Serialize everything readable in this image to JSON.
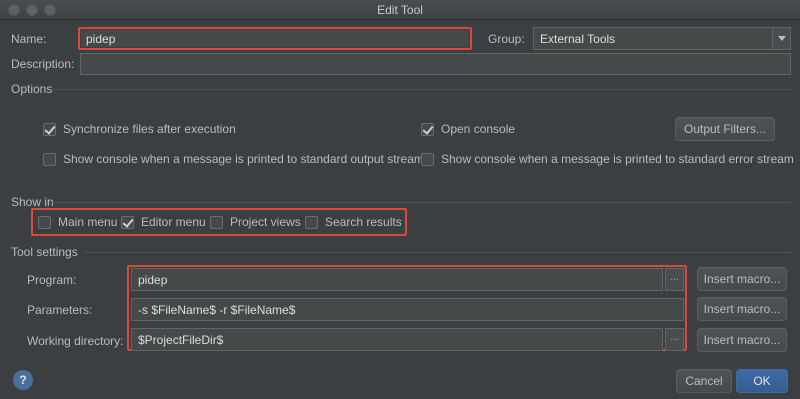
{
  "window": {
    "title": "Edit Tool"
  },
  "name": {
    "label": "Name:",
    "value": "pidep"
  },
  "group": {
    "label": "Group:",
    "value": "External Tools"
  },
  "description": {
    "label": "Description:",
    "value": ""
  },
  "options": {
    "title": "Options",
    "sync_files": {
      "label": "Synchronize files after execution",
      "checked": true
    },
    "open_console": {
      "label": "Open console",
      "checked": true
    },
    "output_filters_label": "Output Filters...",
    "show_console_stdout": {
      "label": "Show console when a message is printed to standard output stream",
      "checked": false
    },
    "show_console_stderr": {
      "label": "Show console when a message is printed to standard error stream",
      "checked": false
    }
  },
  "show_in": {
    "title": "Show in",
    "main_menu": {
      "label": "Main menu",
      "checked": false
    },
    "editor_menu": {
      "label": "Editor menu",
      "checked": true
    },
    "project_views": {
      "label": "Project views",
      "checked": false
    },
    "search_results": {
      "label": "Search results",
      "checked": false
    }
  },
  "tool_settings": {
    "title": "Tool settings",
    "program": {
      "label": "Program:",
      "value": "pidep"
    },
    "parameters": {
      "label": "Parameters:",
      "value": "-s $FileName$ -r $FileName$"
    },
    "working_directory": {
      "label": "Working directory:",
      "value": "$ProjectFileDir$"
    },
    "insert_macro_label": "Insert macro...",
    "browse_label": "..."
  },
  "footer": {
    "help_label": "?",
    "cancel_label": "Cancel",
    "ok_label": "OK"
  },
  "colors": {
    "background": "#3c3f41",
    "highlight": "#d94a3a",
    "primary": "#3f6aa4"
  }
}
